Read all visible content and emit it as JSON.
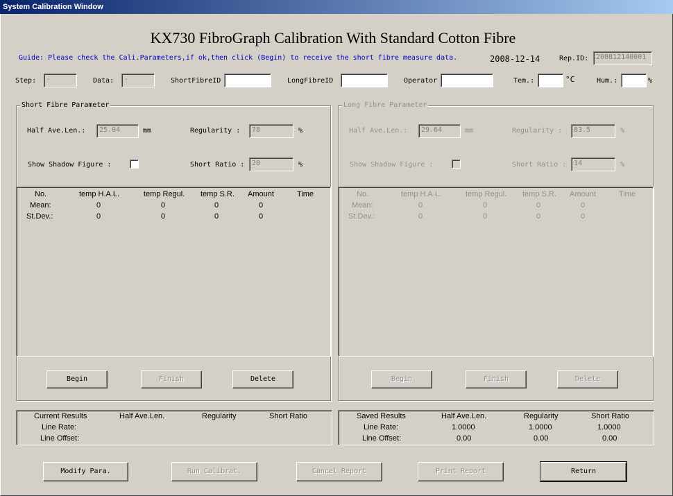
{
  "window": {
    "title": "System Calibration Window"
  },
  "header": {
    "main_title": "KX730 FibroGraph Calibration With Standard Cotton Fibre",
    "guide": "Guide: Please check the Cali.Parameters,if ok,then click (Begin) to receive the short fibre measure data.",
    "date": "2008-12-14",
    "rep_id_label": "Rep.ID:",
    "rep_id_value": "200812140001"
  },
  "params": {
    "step_label": "Step:",
    "step_value": "-",
    "data_label": "Data:",
    "data_value": "-",
    "short_id_label": "ShortFibreID",
    "short_id_value": "",
    "long_id_label": "LongFibreID",
    "long_id_value": "",
    "operator_label": "Operator",
    "operator_value": "",
    "tem_label": "Tem.:",
    "tem_value": "",
    "tem_unit": "°C",
    "hum_label": "Hum.:",
    "hum_value": "",
    "hum_unit": "%"
  },
  "short_group": {
    "title": "Short Fibre Parameter",
    "hal_label": "Half Ave.Len.:",
    "hal_value": "25.04",
    "hal_unit": "mm",
    "reg_label": "Regularity :",
    "reg_value": "78",
    "reg_unit": "%",
    "shadow_label": "Show Shadow Figure :",
    "sr_label": "Short Ratio :",
    "sr_value": "20",
    "sr_unit": "%",
    "table": {
      "headers": [
        "No.",
        "temp H.A.L.",
        "temp Regul.",
        "temp S.R.",
        "Amount",
        "Time"
      ],
      "rows": [
        {
          "label": "Mean:",
          "values": [
            "0",
            "0",
            "0",
            "0"
          ]
        },
        {
          "label": "St.Dev.:",
          "values": [
            "0",
            "0",
            "0",
            "0"
          ]
        }
      ]
    },
    "buttons": {
      "begin": "Begin",
      "finish": "Finish",
      "delete": "Delete"
    }
  },
  "long_group": {
    "title": "Long Fibre Parameter",
    "hal_label": "Half Ave.Len.:",
    "hal_value": "29.64",
    "hal_unit": "mm",
    "reg_label": "Regularity :",
    "reg_value": "83.5",
    "reg_unit": "%",
    "shadow_label": "Show Shadow Figure :",
    "sr_label": "Short Ratio :",
    "sr_value": "14",
    "sr_unit": "%",
    "table": {
      "headers": [
        "No.",
        "temp H.A.L.",
        "temp Regul.",
        "temp S.R.",
        "Amount",
        "Time"
      ],
      "rows": [
        {
          "label": "Mean:",
          "values": [
            "0",
            "0",
            "0",
            "0"
          ]
        },
        {
          "label": "St.Dev.:",
          "values": [
            "0",
            "0",
            "0",
            "0"
          ]
        }
      ]
    },
    "buttons": {
      "begin": "Begin",
      "finish": "Finish",
      "delete": "Delete"
    }
  },
  "current_results": {
    "headers": [
      "Current Results",
      "Half Ave.Len.",
      "Regularity",
      "Short Ratio"
    ],
    "rows": [
      {
        "label": "Line Rate:",
        "values": [
          "",
          "",
          ""
        ]
      },
      {
        "label": "Line Offset:",
        "values": [
          "",
          "",
          ""
        ]
      }
    ]
  },
  "saved_results": {
    "headers": [
      "Saved Results",
      "Half Ave.Len.",
      "Regularity",
      "Short Ratio"
    ],
    "rows": [
      {
        "label": "Line Rate:",
        "values": [
          "1.0000",
          "1.0000",
          "1.0000"
        ]
      },
      {
        "label": "Line Offset:",
        "values": [
          "0.00",
          "0.00",
          "0.00"
        ]
      }
    ]
  },
  "footer": {
    "modify": "Modify Para.",
    "run": "Run Calibrat.",
    "cancel": "Cancel Report",
    "print": "Print Report",
    "return": "Return"
  }
}
